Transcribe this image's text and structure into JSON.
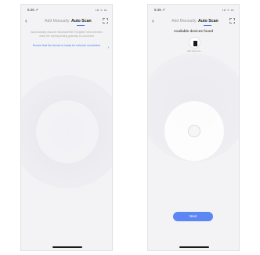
{
  "left_screen": {
    "status": {
      "time": "5:46 ↗",
      "icons": "•ıl ≈ ▭"
    },
    "nav": {
      "tab_manual": "Add Manually",
      "tab_auto": "Auto Scan"
    },
    "description": "Automatically discover Bluetooth/Wi-Fi/Zigbee/ wired devices when the corresponding gateway is connected",
    "ready_link": "Ensure that the device is ready for network connection"
  },
  "right_screen": {
    "status": {
      "time": "5:46 ↗",
      "icons": "•ıl ≈ ▭"
    },
    "nav": {
      "tab_manual": "Add Manually",
      "tab_auto": "Auto Scan"
    },
    "found_title": "Available devices found",
    "device_label": "Mini Smart Ca...",
    "next_label": "Next"
  },
  "icons": {
    "back": "chevron-left-icon",
    "scan": "scan-frame-icon",
    "device": "camera-device-icon"
  },
  "colors": {
    "accent": "#4a7cf6",
    "button": "#5b86f3",
    "background": "#f3f3f5"
  }
}
